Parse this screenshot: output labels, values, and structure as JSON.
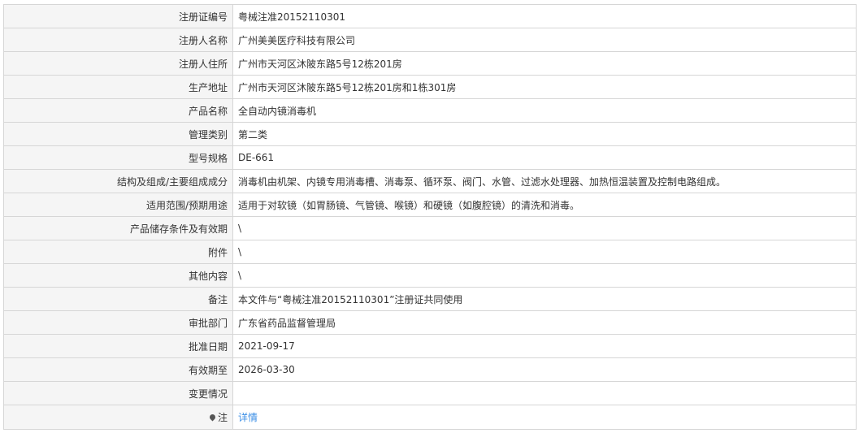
{
  "rows": [
    {
      "label": "注册证编号",
      "value": "粤械注准20152110301"
    },
    {
      "label": "注册人名称",
      "value": "广州美美医疗科技有限公司"
    },
    {
      "label": "注册人住所",
      "value": "广州市天河区沐陂东路5号12栋201房"
    },
    {
      "label": "生产地址",
      "value": "广州市天河区沐陂东路5号12栋201房和1栋301房"
    },
    {
      "label": "产品名称",
      "value": "全自动内镜消毒机"
    },
    {
      "label": "管理类别",
      "value": "第二类"
    },
    {
      "label": "型号规格",
      "value": "DE-661"
    },
    {
      "label": "结构及组成/主要组成成分",
      "value": "消毒机由机架、内镜专用消毒槽、消毒泵、循环泵、阀门、水管、过滤水处理器、加热恒温装置及控制电路组成。"
    },
    {
      "label": "适用范围/预期用途",
      "value": "适用于对软镜（如胃肠镜、气管镜、喉镜）和硬镜（如腹腔镜）的清洗和消毒。"
    },
    {
      "label": "产品储存条件及有效期",
      "value": "\\"
    },
    {
      "label": "附件",
      "value": "\\"
    },
    {
      "label": "其他内容",
      "value": "\\"
    },
    {
      "label": "备注",
      "value": "本文件与“粤械注准20152110301”注册证共同使用"
    },
    {
      "label": "审批部门",
      "value": "广东省药品监督管理局"
    },
    {
      "label": "批准日期",
      "value": "2021-09-17"
    },
    {
      "label": "有效期至",
      "value": "2026-03-30"
    },
    {
      "label": "变更情况",
      "value": ""
    }
  ],
  "note": {
    "icon": "map-pin-icon",
    "label": "注",
    "link_text": "详情",
    "link_color": "#3a8ee6"
  }
}
